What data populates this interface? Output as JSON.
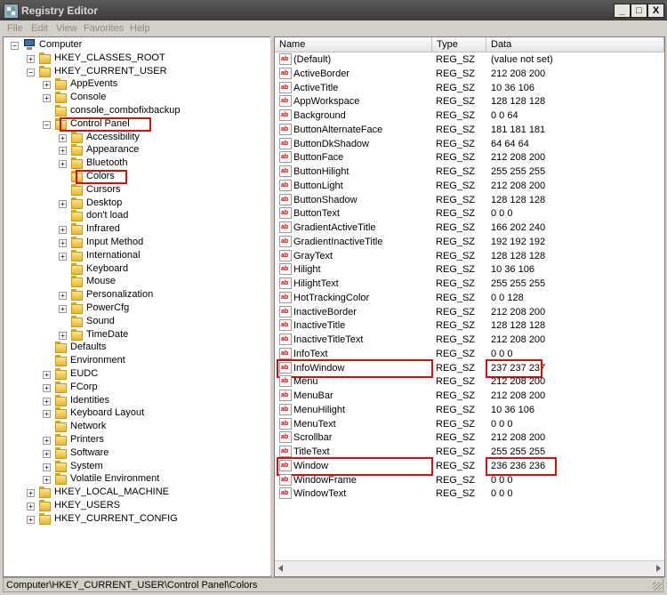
{
  "window": {
    "title": "Registry Editor",
    "minimize": "_",
    "maximize": "□",
    "close": "X"
  },
  "menu": [
    "File",
    "Edit",
    "View",
    "Favorites",
    "Help"
  ],
  "tree": [
    {
      "label": "Computer",
      "level": 0,
      "expander": "-",
      "icon": "computer-icon"
    },
    {
      "label": "HKEY_CLASSES_ROOT",
      "level": 1,
      "expander": "+"
    },
    {
      "label": "HKEY_CURRENT_USER",
      "level": 1,
      "expander": "-"
    },
    {
      "label": "AppEvents",
      "level": 2,
      "expander": "+"
    },
    {
      "label": "Console",
      "level": 2,
      "expander": "+"
    },
    {
      "label": "console_combofixbackup",
      "level": 2,
      "expander": ""
    },
    {
      "label": "Control Panel",
      "level": 2,
      "expander": "-",
      "highlight": true
    },
    {
      "label": "Accessibility",
      "level": 3,
      "expander": "+"
    },
    {
      "label": "Appearance",
      "level": 3,
      "expander": "+"
    },
    {
      "label": "Bluetooth",
      "level": 3,
      "expander": "+"
    },
    {
      "label": "Colors",
      "level": 3,
      "expander": "",
      "highlight": true,
      "selected": true
    },
    {
      "label": "Cursors",
      "level": 3,
      "expander": ""
    },
    {
      "label": "Desktop",
      "level": 3,
      "expander": "+"
    },
    {
      "label": "don't load",
      "level": 3,
      "expander": ""
    },
    {
      "label": "Infrared",
      "level": 3,
      "expander": "+"
    },
    {
      "label": "Input Method",
      "level": 3,
      "expander": "+"
    },
    {
      "label": "International",
      "level": 3,
      "expander": "+"
    },
    {
      "label": "Keyboard",
      "level": 3,
      "expander": ""
    },
    {
      "label": "Mouse",
      "level": 3,
      "expander": ""
    },
    {
      "label": "Personalization",
      "level": 3,
      "expander": "+"
    },
    {
      "label": "PowerCfg",
      "level": 3,
      "expander": "+"
    },
    {
      "label": "Sound",
      "level": 3,
      "expander": ""
    },
    {
      "label": "TimeDate",
      "level": 3,
      "expander": "+"
    },
    {
      "label": "Defaults",
      "level": 2,
      "expander": ""
    },
    {
      "label": "Environment",
      "level": 2,
      "expander": ""
    },
    {
      "label": "EUDC",
      "level": 2,
      "expander": "+"
    },
    {
      "label": "FCorp",
      "level": 2,
      "expander": "+"
    },
    {
      "label": "Identities",
      "level": 2,
      "expander": "+"
    },
    {
      "label": "Keyboard Layout",
      "level": 2,
      "expander": "+"
    },
    {
      "label": "Network",
      "level": 2,
      "expander": ""
    },
    {
      "label": "Printers",
      "level": 2,
      "expander": "+"
    },
    {
      "label": "Software",
      "level": 2,
      "expander": "+"
    },
    {
      "label": "System",
      "level": 2,
      "expander": "+"
    },
    {
      "label": "Volatile Environment",
      "level": 2,
      "expander": "+"
    },
    {
      "label": "HKEY_LOCAL_MACHINE",
      "level": 1,
      "expander": "+"
    },
    {
      "label": "HKEY_USERS",
      "level": 1,
      "expander": "+"
    },
    {
      "label": "HKEY_CURRENT_CONFIG",
      "level": 1,
      "expander": "+"
    }
  ],
  "columns": {
    "name": "Name",
    "type": "Type",
    "data": "Data"
  },
  "values": [
    {
      "name": "(Default)",
      "type": "REG_SZ",
      "data": "(value not set)"
    },
    {
      "name": "ActiveBorder",
      "type": "REG_SZ",
      "data": "212 208 200"
    },
    {
      "name": "ActiveTitle",
      "type": "REG_SZ",
      "data": "10 36 106"
    },
    {
      "name": "AppWorkspace",
      "type": "REG_SZ",
      "data": "128 128 128"
    },
    {
      "name": "Background",
      "type": "REG_SZ",
      "data": "0 0 64"
    },
    {
      "name": "ButtonAlternateFace",
      "type": "REG_SZ",
      "data": "181 181 181"
    },
    {
      "name": "ButtonDkShadow",
      "type": "REG_SZ",
      "data": "64 64 64"
    },
    {
      "name": "ButtonFace",
      "type": "REG_SZ",
      "data": "212 208 200"
    },
    {
      "name": "ButtonHilight",
      "type": "REG_SZ",
      "data": "255 255 255"
    },
    {
      "name": "ButtonLight",
      "type": "REG_SZ",
      "data": "212 208 200"
    },
    {
      "name": "ButtonShadow",
      "type": "REG_SZ",
      "data": "128 128 128"
    },
    {
      "name": "ButtonText",
      "type": "REG_SZ",
      "data": "0 0 0"
    },
    {
      "name": "GradientActiveTitle",
      "type": "REG_SZ",
      "data": "166 202 240"
    },
    {
      "name": "GradientInactiveTitle",
      "type": "REG_SZ",
      "data": "192 192 192"
    },
    {
      "name": "GrayText",
      "type": "REG_SZ",
      "data": "128 128 128"
    },
    {
      "name": "Hilight",
      "type": "REG_SZ",
      "data": "10 36 106"
    },
    {
      "name": "HilightText",
      "type": "REG_SZ",
      "data": "255 255 255"
    },
    {
      "name": "HotTrackingColor",
      "type": "REG_SZ",
      "data": "0 0 128"
    },
    {
      "name": "InactiveBorder",
      "type": "REG_SZ",
      "data": "212 208 200"
    },
    {
      "name": "InactiveTitle",
      "type": "REG_SZ",
      "data": "128 128 128"
    },
    {
      "name": "InactiveTitleText",
      "type": "REG_SZ",
      "data": "212 208 200"
    },
    {
      "name": "InfoText",
      "type": "REG_SZ",
      "data": "0 0 0"
    },
    {
      "name": "InfoWindow",
      "type": "REG_SZ",
      "data": "237 237 237",
      "highlight": true
    },
    {
      "name": "Menu",
      "type": "REG_SZ",
      "data": "212 208 200"
    },
    {
      "name": "MenuBar",
      "type": "REG_SZ",
      "data": "212 208 200"
    },
    {
      "name": "MenuHilight",
      "type": "REG_SZ",
      "data": "10 36 106"
    },
    {
      "name": "MenuText",
      "type": "REG_SZ",
      "data": "0 0 0"
    },
    {
      "name": "Scrollbar",
      "type": "REG_SZ",
      "data": "212 208 200"
    },
    {
      "name": "TitleText",
      "type": "REG_SZ",
      "data": "255 255 255"
    },
    {
      "name": "Window",
      "type": "REG_SZ",
      "data": "236 236 236",
      "highlight": true
    },
    {
      "name": "WindowFrame",
      "type": "REG_SZ",
      "data": "0 0 0"
    },
    {
      "name": "WindowText",
      "type": "REG_SZ",
      "data": "0 0 0"
    }
  ],
  "value_icon_text": "ab",
  "status": "Computer\\HKEY_CURRENT_USER\\Control Panel\\Colors",
  "colors": {
    "highlight_box": "#cc1111",
    "folder": "#f3cd55"
  }
}
